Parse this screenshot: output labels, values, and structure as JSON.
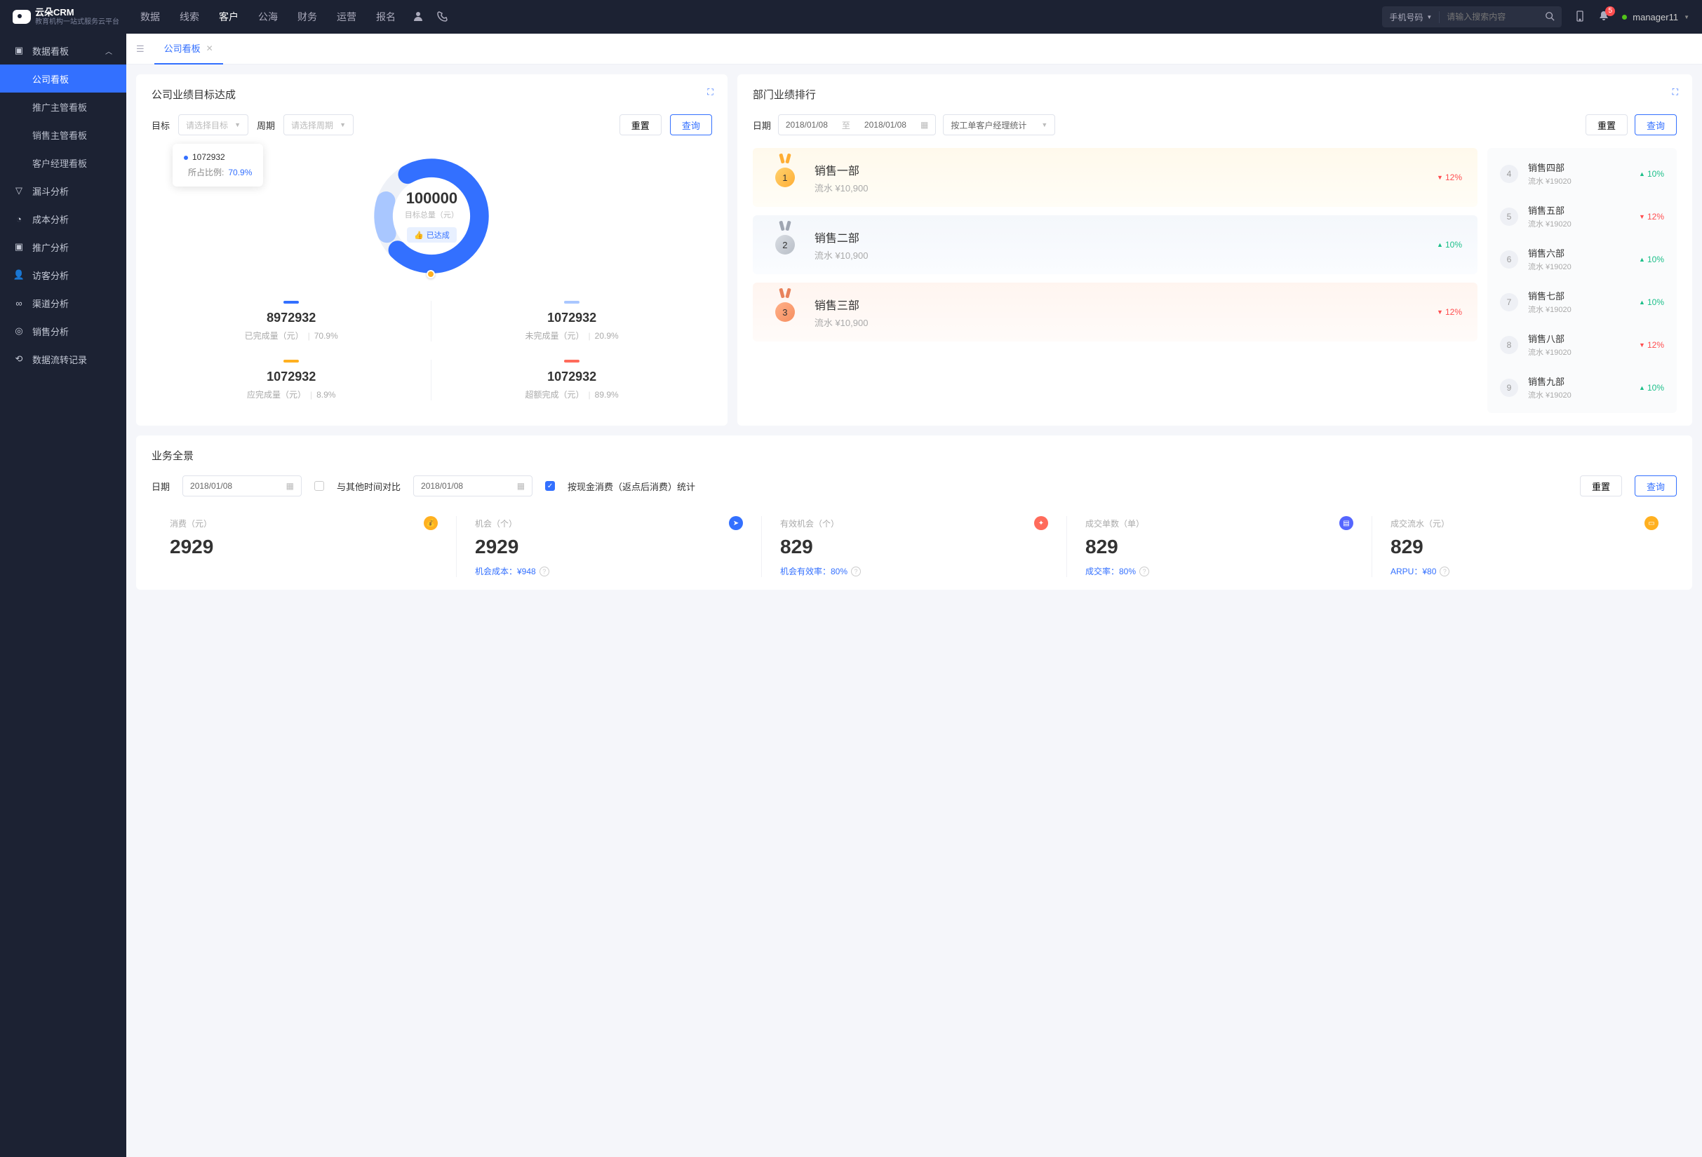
{
  "brand": {
    "name": "云朵CRM",
    "sub": "教育机构一站式服务云平台"
  },
  "topnav": [
    "数据",
    "线索",
    "客户",
    "公海",
    "财务",
    "运营",
    "报名"
  ],
  "topnav_active": 2,
  "search": {
    "type": "手机号码",
    "placeholder": "请输入搜索内容"
  },
  "notif_count": "5",
  "user": "manager11",
  "sidebar": {
    "group": "数据看板",
    "subs": [
      "公司看板",
      "推广主管看板",
      "销售主管看板",
      "客户经理看板"
    ],
    "sub_active": 0,
    "items": [
      "漏斗分析",
      "成本分析",
      "推广分析",
      "访客分析",
      "渠道分析",
      "销售分析",
      "数据流转记录"
    ]
  },
  "tab": {
    "label": "公司看板"
  },
  "goal": {
    "title": "公司业绩目标达成",
    "target_lbl": "目标",
    "target_ph": "请选择目标",
    "period_lbl": "周期",
    "period_ph": "请选择周期",
    "reset": "重置",
    "query": "查询",
    "tooltip_val": "1072932",
    "tooltip_lbl": "所占比例:",
    "tooltip_pct": "70.9%",
    "center_val": "100000",
    "center_lbl": "目标总量（元）",
    "center_tag": "已达成",
    "stats": [
      {
        "color": "#3370ff",
        "val": "8972932",
        "lbl": "已完成量（元）",
        "pct": "70.9%"
      },
      {
        "color": "#a9c7ff",
        "val": "1072932",
        "lbl": "未完成量（元）",
        "pct": "20.9%"
      },
      {
        "color": "#ffb020",
        "val": "1072932",
        "lbl": "应完成量（元）",
        "pct": "8.9%"
      },
      {
        "color": "#ff6b5b",
        "val": "1072932",
        "lbl": "超额完成（元）",
        "pct": "89.9%"
      }
    ]
  },
  "rank": {
    "title": "部门业绩排行",
    "date_lbl": "日期",
    "date_from": "2018/01/08",
    "date_to_lbl": "至",
    "date_to": "2018/01/08",
    "stat_sel": "按工单客户经理统计",
    "reset": "重置",
    "query": "查询",
    "top3": [
      {
        "name": "销售一部",
        "rev": "流水 ¥10,900",
        "chg": "12%",
        "dir": "down"
      },
      {
        "name": "销售二部",
        "rev": "流水 ¥10,900",
        "chg": "10%",
        "dir": "up"
      },
      {
        "name": "销售三部",
        "rev": "流水 ¥10,900",
        "chg": "12%",
        "dir": "down"
      }
    ],
    "rest": [
      {
        "n": "4",
        "name": "销售四部",
        "rev": "流水 ¥19020",
        "chg": "10%",
        "dir": "up"
      },
      {
        "n": "5",
        "name": "销售五部",
        "rev": "流水 ¥19020",
        "chg": "12%",
        "dir": "down"
      },
      {
        "n": "6",
        "name": "销售六部",
        "rev": "流水 ¥19020",
        "chg": "10%",
        "dir": "up"
      },
      {
        "n": "7",
        "name": "销售七部",
        "rev": "流水 ¥19020",
        "chg": "10%",
        "dir": "up"
      },
      {
        "n": "8",
        "name": "销售八部",
        "rev": "流水 ¥19020",
        "chg": "12%",
        "dir": "down"
      },
      {
        "n": "9",
        "name": "销售九部",
        "rev": "流水 ¥19020",
        "chg": "10%",
        "dir": "up"
      }
    ]
  },
  "overview": {
    "title": "业务全景",
    "date_lbl": "日期",
    "date": "2018/01/08",
    "compare_lbl": "与其他时间对比",
    "date2": "2018/01/08",
    "chk_lbl": "按现金消费（返点后消费）统计",
    "reset": "重置",
    "query": "查询",
    "kpis": [
      {
        "label": "消费（元）",
        "val": "2929",
        "ft": "",
        "ic": "#ffb020",
        "glyph": "💰"
      },
      {
        "label": "机会（个）",
        "val": "2929",
        "ft": "机会成本：¥948",
        "ic": "#3370ff",
        "glyph": "➤"
      },
      {
        "label": "有效机会（个）",
        "val": "829",
        "ft": "机会有效率：80%",
        "ic": "#ff6b5b",
        "glyph": "✦"
      },
      {
        "label": "成交单数（单）",
        "val": "829",
        "ft": "成交率：80%",
        "ic": "#5566ff",
        "glyph": "▤"
      },
      {
        "label": "成交流水（元）",
        "val": "829",
        "ft": "ARPU：¥80",
        "ic": "#ffb020",
        "glyph": "▭"
      }
    ]
  },
  "chart_data": {
    "type": "pie",
    "title": "目标总量（元）100000",
    "series": [
      {
        "name": "已完成量（元）",
        "value": 8972932,
        "pct": 70.9,
        "color": "#3370ff"
      },
      {
        "name": "未完成量（元）",
        "value": 1072932,
        "pct": 20.9,
        "color": "#a9c7ff"
      },
      {
        "name": "应完成量（元）",
        "value": 1072932,
        "pct": 8.9,
        "color": "#ffb020"
      },
      {
        "name": "超额完成（元）",
        "value": 1072932,
        "pct": 89.9,
        "color": "#ff6b5b"
      }
    ]
  }
}
